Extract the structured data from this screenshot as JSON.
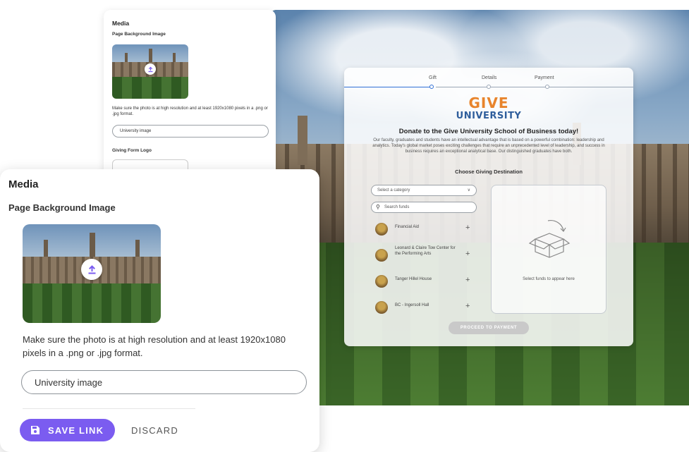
{
  "preview": {
    "steps": [
      "Gift",
      "Details",
      "Payment"
    ],
    "logo_top": "GIVE",
    "logo_bottom": "UNIVERSITY",
    "title": "Donate to the Give University School of Business today!",
    "description": "Our faculty, graduates and students have an intellectual advantage that is based on a powerful combination: leadership and analytics. Today's global market poses exciting challenges that require an unprecedented level of leadership, and success in business requires an exceptional analytical base. Our distinguished graduates have both.",
    "subtitle": "Choose Giving Destination",
    "category_placeholder": "Select a category",
    "search_placeholder": "Search funds",
    "funds": [
      "Financial Aid",
      "Leonard & Claire Tow Center for the Performing Arts",
      "Tanger Hillel House",
      "BC - Ingersoll Hall"
    ],
    "empty_text": "Select funds to appear here",
    "proceed_label": "PROCEED TO PAYMENT"
  },
  "back_panel": {
    "title": "Media",
    "background_label": "Page Background Image",
    "help": "Make sure the photo is at high resolution and at least 1920x1080 pixels in a .png or .jpg format.",
    "input_value": "University image",
    "logo_label": "Giving Form Logo"
  },
  "front_panel": {
    "title": "Media",
    "background_label": "Page Background Image",
    "help": "Make sure the photo is at high resolution and at least 1920x1080 pixels in a .png or .jpg format.",
    "input_value": "University image",
    "save_label": "SAVE LINK",
    "discard_label": "DISCARD"
  },
  "colors": {
    "accent": "#7b5cf0",
    "active_step": "#2f6fd6",
    "logo_orange": "#e8842c",
    "logo_blue": "#2f5e9c"
  }
}
